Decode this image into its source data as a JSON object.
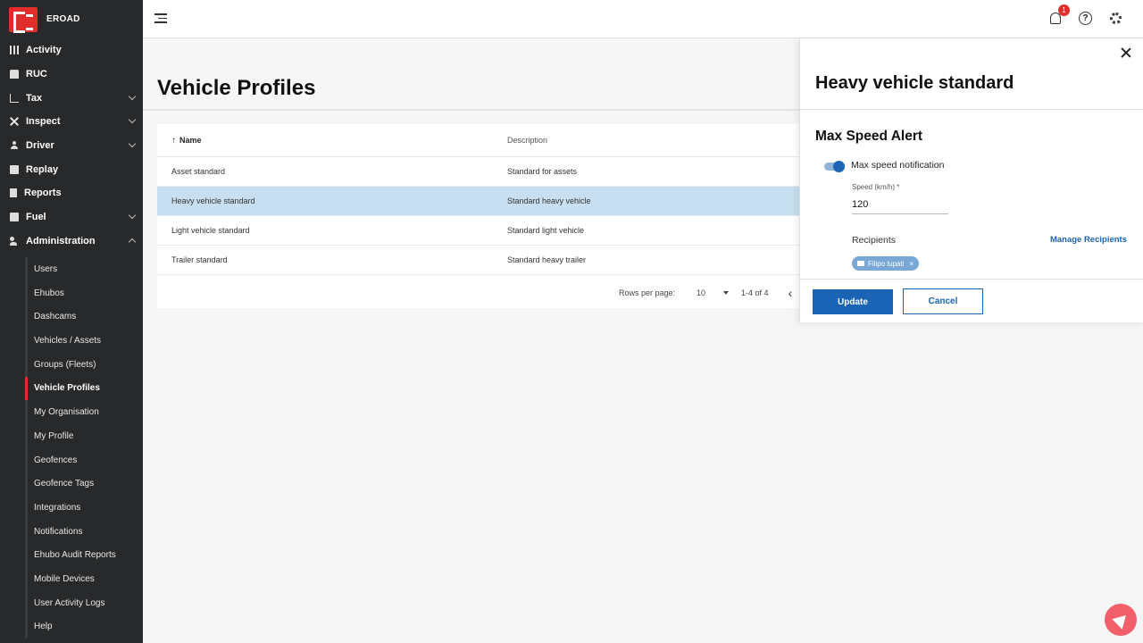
{
  "brand": {
    "name": "EROAD"
  },
  "sidebar": {
    "items": [
      {
        "label": "Activity",
        "icon": "map-icon"
      },
      {
        "label": "RUC",
        "icon": "truck-icon"
      },
      {
        "label": "Tax",
        "icon": "chart-icon"
      },
      {
        "label": "Inspect",
        "icon": "tools-icon"
      },
      {
        "label": "Driver",
        "icon": "person-icon"
      },
      {
        "label": "Replay",
        "icon": "camera-icon"
      },
      {
        "label": "Reports",
        "icon": "document-icon"
      },
      {
        "label": "Fuel",
        "icon": "fuel-icon"
      },
      {
        "label": "Administration",
        "icon": "admin-icon"
      }
    ],
    "admin_sub": [
      "Users",
      "Ehubos",
      "Dashcams",
      "Vehicles / Assets",
      "Groups (Fleets)",
      "Vehicle Profiles",
      "My Organisation",
      "My Profile",
      "Geofences",
      "Geofence Tags",
      "Integrations",
      "Notifications",
      "Ehubo Audit Reports",
      "Mobile Devices",
      "User Activity Logs",
      "Help"
    ]
  },
  "topbar": {
    "notification_count": "1",
    "help_glyph": "?"
  },
  "page": {
    "title": "Vehicle Profiles"
  },
  "table": {
    "headers": {
      "name": "Name",
      "description": "Description",
      "sort_glyph": "↑"
    },
    "rows": [
      {
        "name": "Asset standard",
        "description": "Standard for assets"
      },
      {
        "name": "Heavy vehicle standard",
        "description": "Standard heavy vehicle"
      },
      {
        "name": "Light vehicle standard",
        "description": "Standard light vehicle"
      },
      {
        "name": "Trailer standard",
        "description": "Standard heavy trailer"
      }
    ],
    "pager": {
      "rows_per_page_label": "Rows per page:",
      "rows_per_page": "10",
      "range": "1-4 of 4",
      "prev_glyph": "‹"
    }
  },
  "drawer": {
    "title": "Heavy vehicle standard",
    "section_title": "Max Speed Alert",
    "toggle_label": "Max speed notification",
    "speed_label": "Speed (km/h) *",
    "speed_value": "120",
    "recipients_label": "Recipients",
    "manage_link": "Manage Recipients",
    "recipient_chip": "Filipo lupati",
    "chip_remove": "×",
    "update_label": "Update",
    "cancel_label": "Cancel"
  },
  "colors": {
    "accent": "#1a63b5",
    "brand_red": "#e22d2d",
    "sidebar_bg": "#27292b",
    "selected_row": "#c7dff0"
  }
}
